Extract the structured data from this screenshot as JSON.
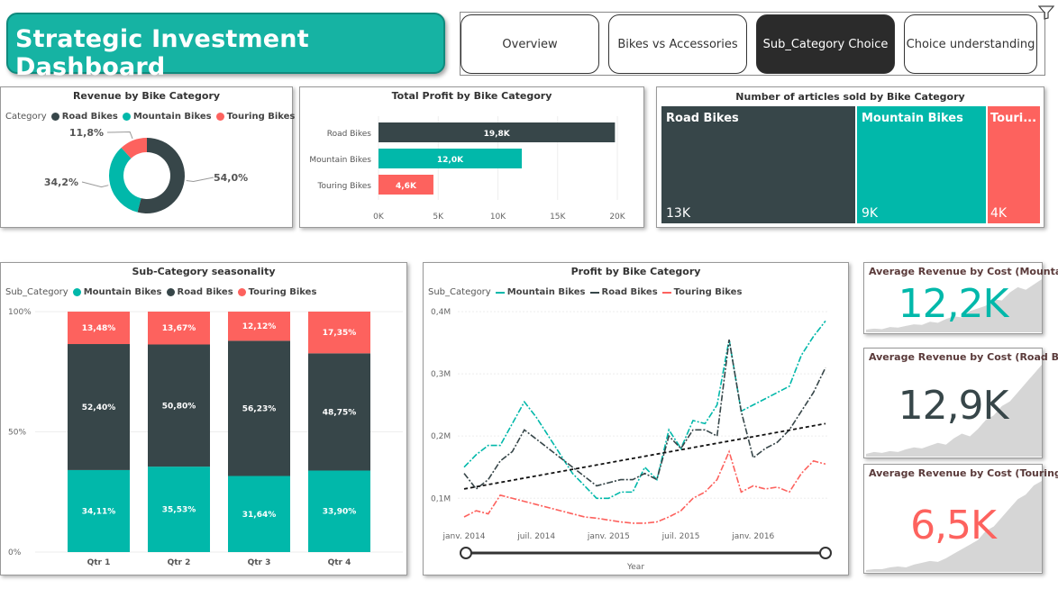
{
  "header": {
    "title": "Strategic Investment Dashboard"
  },
  "nav": {
    "tabs": [
      {
        "label": "Overview",
        "active": false
      },
      {
        "label": "Bikes vs Accessories",
        "active": false
      },
      {
        "label": "Sub_Category Choice",
        "active": true
      },
      {
        "label": "Choice understanding",
        "active": false
      }
    ]
  },
  "colors": {
    "road": "#374649",
    "mountain": "#01b8aa",
    "touring": "#fd625e",
    "accent": "#16b3a3"
  },
  "revenue_card": {
    "title": "Revenue by Bike Category",
    "legend_label": "Category",
    "legend": [
      "Road Bikes",
      "Mountain Bikes",
      "Touring Bikes"
    ]
  },
  "profit_card": {
    "title": "Total Profit by Bike Category"
  },
  "articles_card": {
    "title": "Number of articles sold by Bike Category",
    "tiles": [
      {
        "label": "Road Bikes",
        "value": "13K"
      },
      {
        "label": "Mountain Bikes",
        "value": "9K"
      },
      {
        "label": "Touri...",
        "value": "4K"
      }
    ]
  },
  "seasonality_card": {
    "title": "Sub-Category seasonality",
    "legend_label": "Sub_Category",
    "legend": [
      "Mountain Bikes",
      "Road Bikes",
      "Touring Bikes"
    ]
  },
  "line_card": {
    "title": "Profit by Bike Category",
    "legend_label": "Sub_Category",
    "legend": [
      "Mountain Bikes",
      "Road Bikes",
      "Touring Bikes"
    ],
    "xlabel": "Year"
  },
  "kpis": [
    {
      "title": "Average Revenue by Cost (Mounta...",
      "value": "12,2K",
      "color": "#01b8aa"
    },
    {
      "title": "Average Revenue by Cost (Road Bi...",
      "value": "12,9K",
      "color": "#374649"
    },
    {
      "title": "Average Revenue by Cost (Touring...",
      "value": "6,5K",
      "color": "#fd625e"
    }
  ],
  "chart_data": [
    {
      "type": "pie",
      "title": "Revenue by Bike Category",
      "categories": [
        "Road Bikes",
        "Mountain Bikes",
        "Touring Bikes"
      ],
      "values": [
        54.0,
        34.2,
        11.8
      ],
      "labels": [
        "54,0%",
        "34,2%",
        "11,8%"
      ]
    },
    {
      "type": "bar",
      "title": "Total Profit by Bike Category",
      "categories": [
        "Road Bikes",
        "Mountain Bikes",
        "Touring Bikes"
      ],
      "values": [
        19800,
        12000,
        4600
      ],
      "labels": [
        "19,8K",
        "12,0K",
        "4,6K"
      ],
      "xticks": [
        "0K",
        "5K",
        "10K",
        "15K",
        "20K"
      ],
      "xlim": [
        0,
        20000
      ]
    },
    {
      "type": "bar",
      "title": "Sub-Category seasonality",
      "stacked": "percent",
      "categories": [
        "Qtr 1",
        "Qtr 2",
        "Qtr 3",
        "Qtr 4"
      ],
      "series": [
        {
          "name": "Mountain Bikes",
          "values": [
            34.11,
            35.53,
            31.64,
            33.9
          ],
          "labels": [
            "34,11%",
            "35,53%",
            "31,64%",
            "33,90%"
          ]
        },
        {
          "name": "Road Bikes",
          "values": [
            52.4,
            50.8,
            56.23,
            48.75
          ],
          "labels": [
            "52,40%",
            "50,80%",
            "56,23%",
            "48,75%"
          ]
        },
        {
          "name": "Touring Bikes",
          "values": [
            13.48,
            13.67,
            12.12,
            17.35
          ],
          "labels": [
            "13,48%",
            "13,67%",
            "12,12%",
            "17,35%"
          ]
        }
      ],
      "yticks": [
        "0%",
        "50%",
        "100%"
      ]
    },
    {
      "type": "line",
      "title": "Profit by Bike Category",
      "xlabel": "Year",
      "x": [
        "2014-01",
        "2014-02",
        "2014-03",
        "2014-04",
        "2014-05",
        "2014-06",
        "2014-07",
        "2014-08",
        "2014-09",
        "2014-10",
        "2014-11",
        "2014-12",
        "2015-01",
        "2015-02",
        "2015-03",
        "2015-04",
        "2015-05",
        "2015-06",
        "2015-07",
        "2015-08",
        "2015-09",
        "2015-10",
        "2015-11",
        "2015-12",
        "2016-01",
        "2016-02",
        "2016-03",
        "2016-04",
        "2016-05",
        "2016-06",
        "2016-07"
      ],
      "xticks": [
        "janv. 2014",
        "juil. 2014",
        "janv. 2015",
        "juil. 2015",
        "janv. 2016"
      ],
      "yticks": [
        "0,1M",
        "0,2M",
        "0,3M",
        "0,4M"
      ],
      "ylim": [
        0.07,
        0.4
      ],
      "series": [
        {
          "name": "Mountain Bikes",
          "values": [
            0.15,
            0.17,
            0.185,
            0.185,
            0.22,
            0.255,
            0.23,
            0.2,
            0.17,
            0.14,
            0.12,
            0.1,
            0.1,
            0.11,
            0.11,
            0.15,
            0.13,
            0.21,
            0.18,
            0.225,
            0.22,
            0.25,
            0.355,
            0.24,
            0.25,
            0.26,
            0.27,
            0.28,
            0.33,
            0.36,
            0.385
          ]
        },
        {
          "name": "Road Bikes",
          "values": [
            0.14,
            0.115,
            0.13,
            0.16,
            0.175,
            0.21,
            0.195,
            0.18,
            0.165,
            0.15,
            0.135,
            0.12,
            0.125,
            0.13,
            0.13,
            0.14,
            0.13,
            0.2,
            0.18,
            0.21,
            0.21,
            0.2,
            0.355,
            0.24,
            0.165,
            0.18,
            0.19,
            0.21,
            0.24,
            0.27,
            0.31
          ]
        },
        {
          "name": "Touring Bikes",
          "values": [
            0.07,
            0.08,
            0.075,
            0.105,
            0.1,
            0.095,
            0.09,
            0.085,
            0.08,
            0.075,
            0.07,
            0.068,
            0.065,
            0.062,
            0.06,
            0.06,
            0.062,
            0.07,
            0.08,
            0.1,
            0.11,
            0.13,
            0.175,
            0.11,
            0.12,
            0.115,
            0.118,
            0.11,
            0.14,
            0.16,
            0.155
          ]
        },
        {
          "name": "Trend",
          "values_endpoints": [
            0.115,
            0.22
          ]
        }
      ]
    },
    {
      "type": "area",
      "title": "Average Revenue by Cost (Mounta...",
      "values": [
        0.05,
        0.07,
        0.06,
        0.1,
        0.09,
        0.12,
        0.15,
        0.14,
        0.2,
        0.18,
        0.25,
        0.3,
        0.28,
        0.4,
        0.45,
        0.5,
        0.62,
        0.6,
        0.75,
        0.85,
        0.8,
        0.9,
        1.0
      ]
    },
    {
      "type": "area",
      "title": "Average Revenue by Cost (Road Bi...",
      "values": [
        0.03,
        0.05,
        0.04,
        0.06,
        0.05,
        0.08,
        0.1,
        0.09,
        0.12,
        0.15,
        0.13,
        0.2,
        0.25,
        0.22,
        0.3,
        0.4,
        0.45,
        0.55,
        0.6,
        0.7,
        0.8,
        0.9,
        1.0
      ]
    },
    {
      "type": "area",
      "title": "Average Revenue by Cost (Touring...",
      "values": [
        0.02,
        0.03,
        0.03,
        0.05,
        0.06,
        0.05,
        0.08,
        0.1,
        0.12,
        0.11,
        0.15,
        0.2,
        0.25,
        0.3,
        0.35,
        0.45,
        0.5,
        0.6,
        0.7,
        0.8,
        0.85,
        0.95,
        1.0
      ]
    }
  ]
}
